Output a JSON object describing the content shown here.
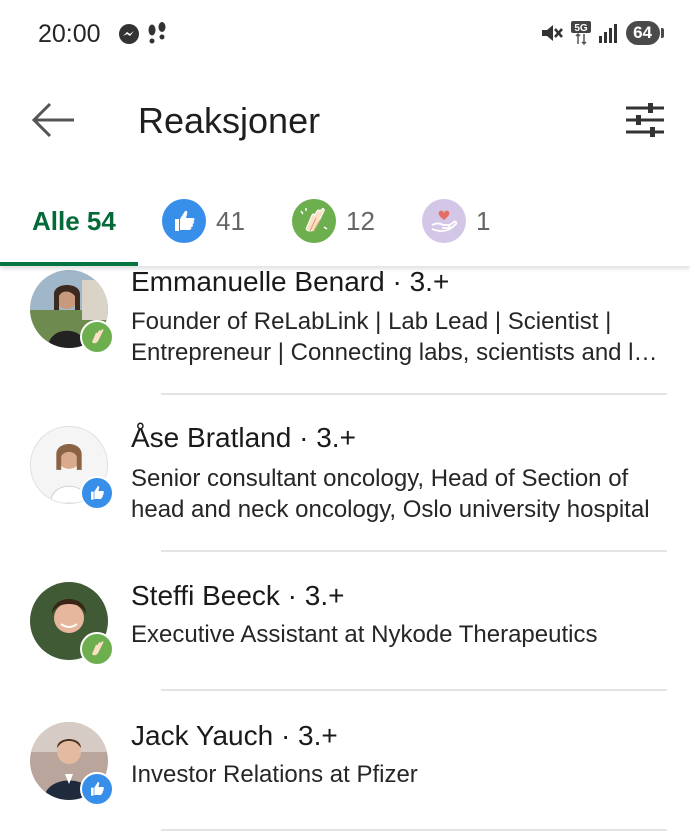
{
  "status_bar": {
    "time": "20:00",
    "left_icons": [
      "messenger-icon",
      "footsteps-icon"
    ],
    "right_icons": [
      "mute-vibrate-icon",
      "5g-icon",
      "signal-icon"
    ],
    "battery": "64"
  },
  "app_bar": {
    "title": "Reaksjoner",
    "back_icon": "arrow-left-icon",
    "filter_icon": "sliders-icon"
  },
  "tabs": [
    {
      "label": "Alle 54",
      "active": true
    },
    {
      "icon": "like-icon",
      "count": "41",
      "color": "#378fe9"
    },
    {
      "icon": "celebrate-icon",
      "count": "12",
      "color": "#6dae4f"
    },
    {
      "icon": "support-icon",
      "count": "1",
      "color": "#bba9d1"
    }
  ],
  "colors": {
    "accent": "#057642",
    "like": "#378fe9",
    "celebrate": "#6dae4f",
    "support": "#bba9d1"
  },
  "people": [
    {
      "name": "Emmanuelle Benard",
      "degree": " · 3.+",
      "headline": "Founder of ReLabLink | Lab Lead | Scientist | Entrepreneur | Connecting labs, scientists and lab resources",
      "reaction": "celebrate-icon"
    },
    {
      "name": "Åse Bratland",
      "degree": " · 3.+",
      "headline": "Senior consultant oncology, Head of Section of head and neck oncology, Oslo university hospital",
      "reaction": "like-icon"
    },
    {
      "name": "Steffi Beeck",
      "degree": " · 3.+",
      "headline": "Executive Assistant at Nykode Therapeutics",
      "reaction": "celebrate-icon"
    },
    {
      "name": "Jack Yauch",
      "degree": " · 3.+",
      "headline": "Investor Relations at Pfizer",
      "reaction": "like-icon"
    }
  ]
}
